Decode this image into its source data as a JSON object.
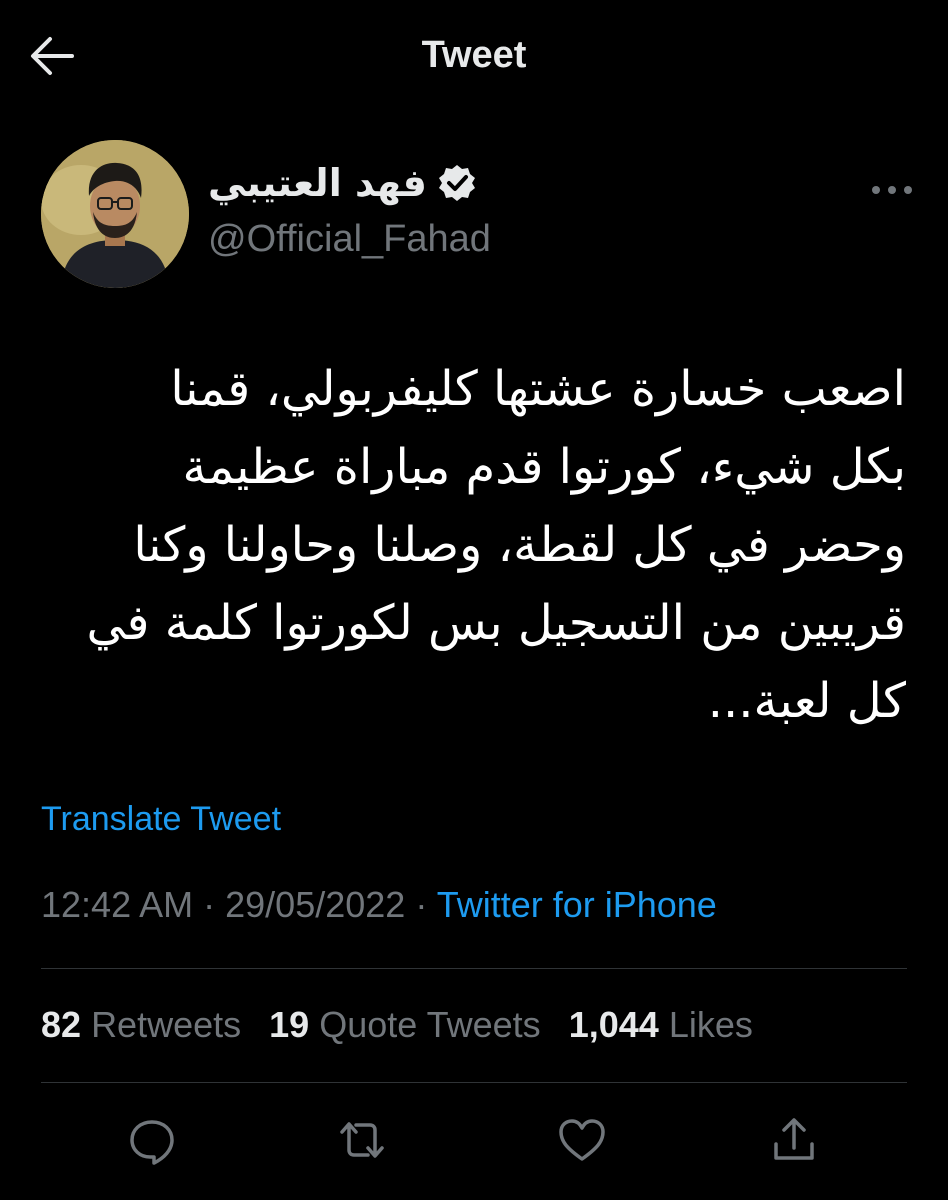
{
  "header": {
    "title": "Tweet",
    "back_icon": "arrow-left-icon"
  },
  "author": {
    "name": "فهد العتيبي",
    "handle": "@Official_Fahad",
    "verified": true,
    "avatar_bg": "#b9a667"
  },
  "tweet": {
    "text": "اصعب خسارة عشتها كليفربولي، قمنا\nبكل شيء، كورتوا قدم مباراة عظيمة\nوحضر في كل لقطة، وصلنا وحاولنا وكنا\nقريبين من التسجيل بس لكورتوا كلمة في\nكل لعبة...",
    "translate_label": "Translate Tweet",
    "time": "12:42 AM",
    "date": "29/05/2022",
    "separator": "·",
    "source": "Twitter for iPhone"
  },
  "stats": {
    "retweets_count": "82",
    "retweets_label": "Retweets",
    "quotes_count": "19",
    "quotes_label": "Quote Tweets",
    "likes_count": "1,044",
    "likes_label": "Likes"
  },
  "actions": [
    "reply-icon",
    "retweet-icon",
    "like-icon",
    "share-icon"
  ],
  "colors": {
    "background": "#000000",
    "text": "#e7e9ea",
    "muted": "#71767b",
    "accent": "#1d9bf0",
    "divider": "#2f3336"
  }
}
